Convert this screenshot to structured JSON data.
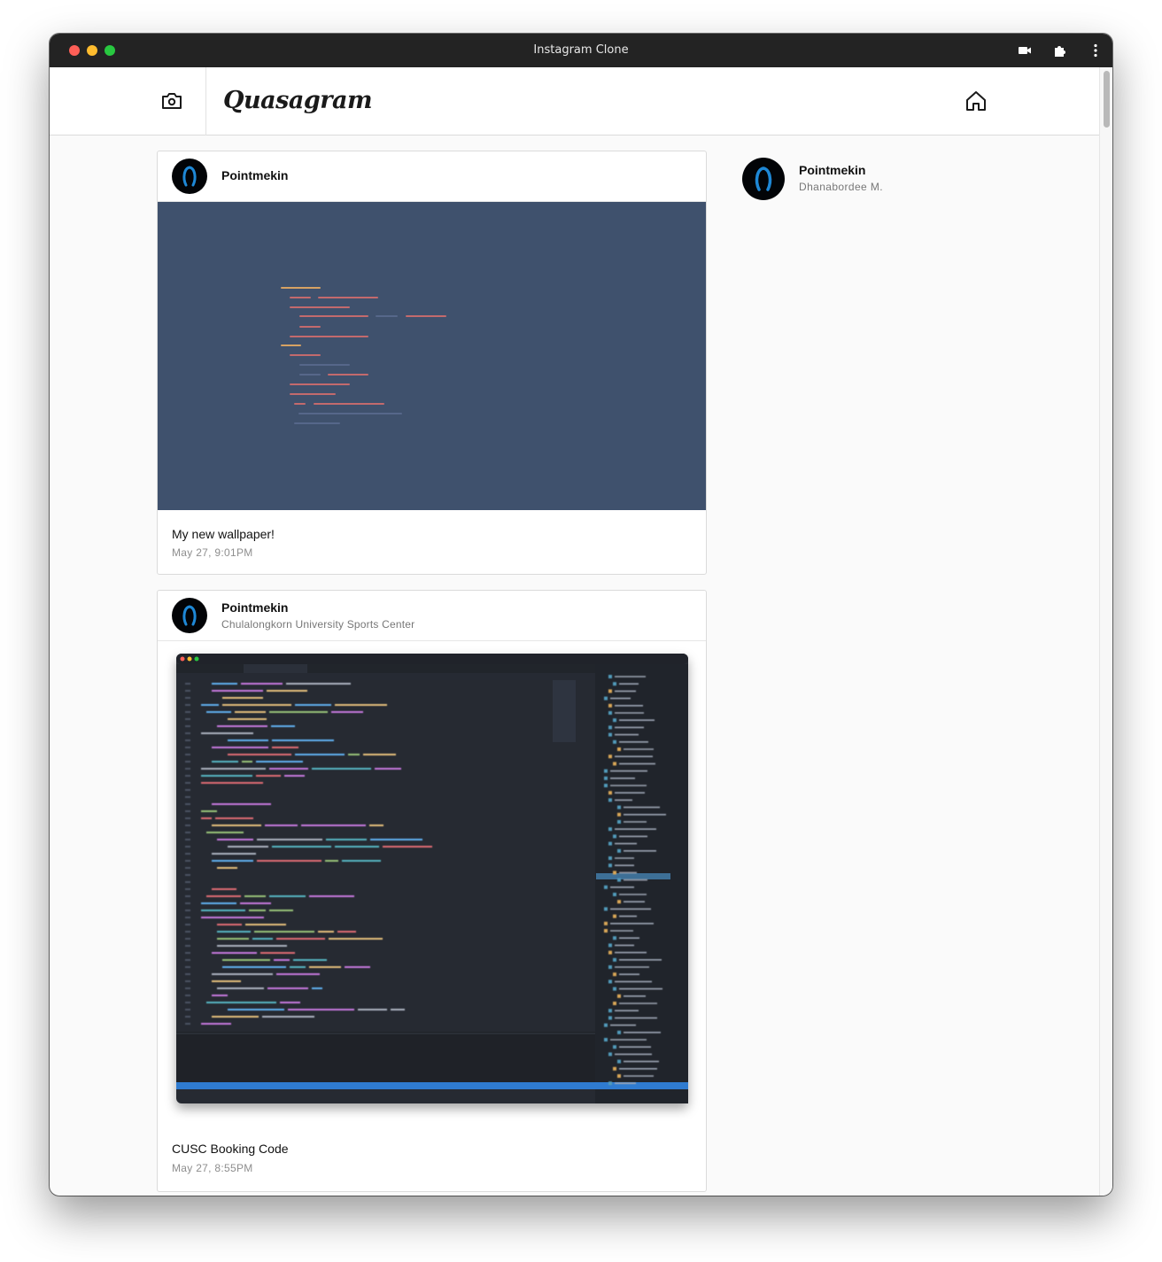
{
  "window": {
    "title": "Instagram Clone",
    "controls": [
      "close",
      "minimize",
      "zoom"
    ],
    "toolbar_icons": [
      "video-camera-icon",
      "extensions-puzzle-icon",
      "more-vertical-icon"
    ]
  },
  "header": {
    "logo": "Quasagram",
    "camera_icon": "camera-icon",
    "home_icon": "home-icon"
  },
  "sidebar_profile": {
    "username": "Pointmekin",
    "full_name": "Dhanabordee M."
  },
  "posts": [
    {
      "username": "Pointmekin",
      "location": "",
      "image": "wallpaper with blurred code lines on a slate-blue background",
      "caption": "My new wallpaper!",
      "date": "May 27, 9:01PM"
    },
    {
      "username": "Pointmekin",
      "location": "Chulalongkorn University Sports Center",
      "image": "screenshot of a code editor",
      "caption": "CUSC Booking Code",
      "date": "May 27, 8:55PM"
    }
  ],
  "colors": {
    "titlebar": "#232323",
    "page_background": "#fafafa",
    "card_border": "#dbdbdb",
    "wallpaper": "#3f516d",
    "editor_background": "#262a33"
  }
}
